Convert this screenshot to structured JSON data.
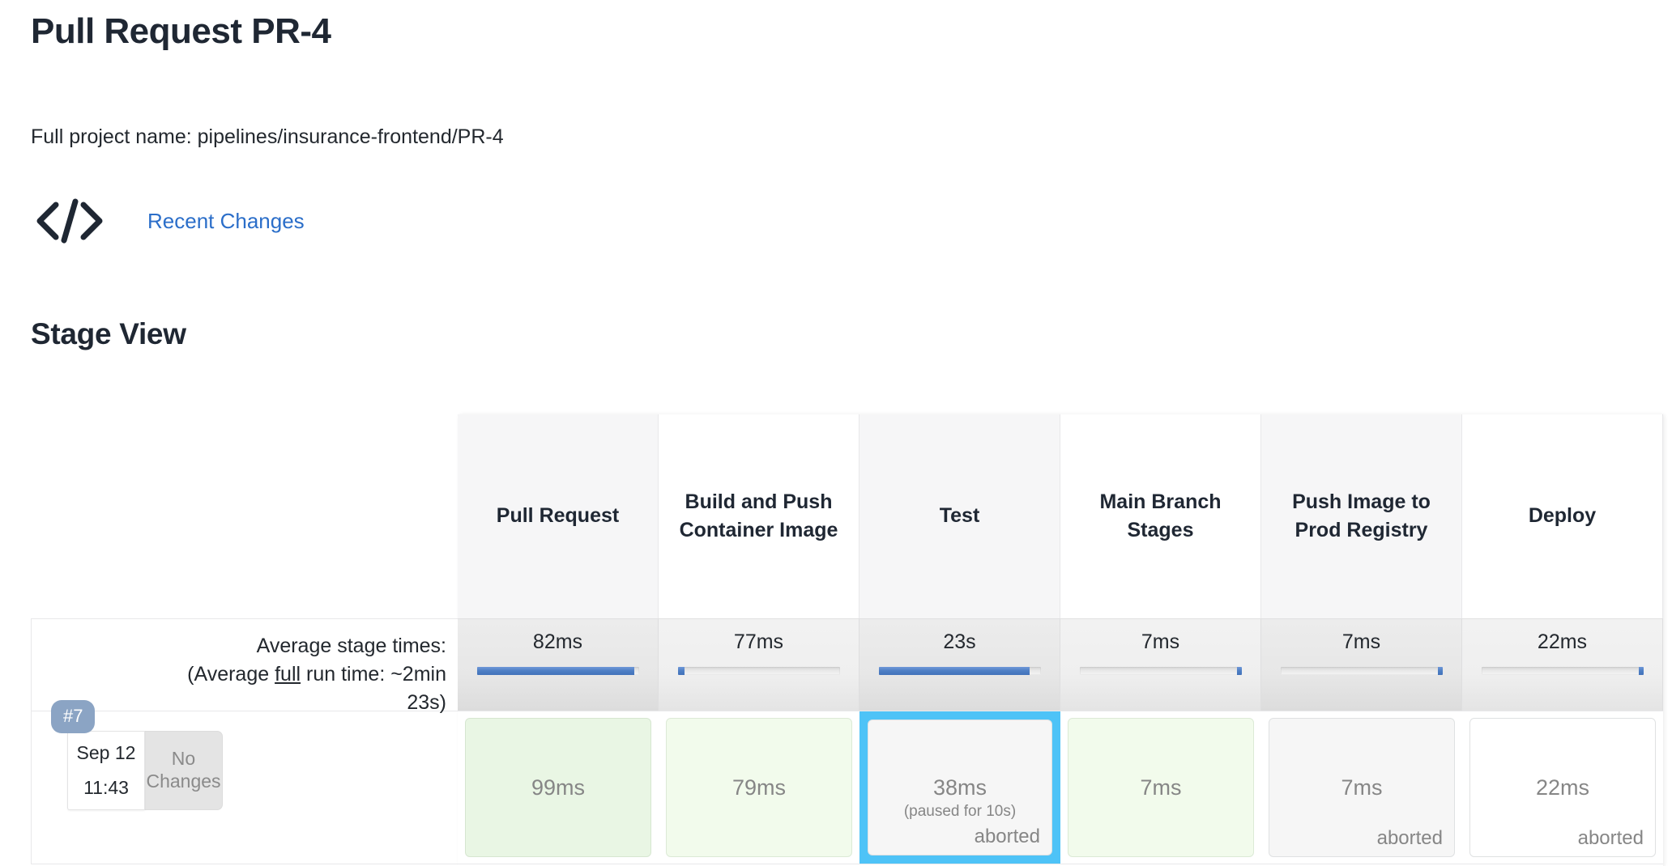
{
  "header": {
    "title": "Pull Request PR-4",
    "project_label": "Full project name: pipelines/insurance-frontend/PR-4",
    "changes_link": "Recent Changes",
    "code_icon": "code-icon",
    "link_color": "#2b6ec9"
  },
  "section": {
    "title": "Stage View"
  },
  "averages": {
    "label_line1": "Average stage times:",
    "label_line2_pre": "(Average ",
    "label_line2_underlined": "full",
    "label_line2_post": " run time: ~2min",
    "label_line3": "23s)"
  },
  "run": {
    "build_number": "#7",
    "date": "Sep 12",
    "time": "11:43",
    "changes": "No Changes"
  },
  "stage_view": {
    "stages": [
      {
        "name": "Pull Request",
        "head_shade": true,
        "avg": "82ms",
        "avg_shade": "dark",
        "bar_pct": 97,
        "bar_side": "left",
        "cell_time": "99ms",
        "cell_style": "green",
        "cell_sub": "",
        "cell_status": "",
        "selected": false
      },
      {
        "name": "Build and Push Container Image",
        "head_shade": false,
        "avg": "77ms",
        "avg_shade": "light",
        "bar_pct": 4,
        "bar_side": "left",
        "cell_time": "79ms",
        "cell_style": "green2",
        "cell_sub": "",
        "cell_status": "",
        "selected": false
      },
      {
        "name": "Test",
        "head_shade": true,
        "avg": "23s",
        "avg_shade": "dark",
        "bar_pct": 93,
        "bar_side": "left",
        "cell_time": "38ms",
        "cell_style": "gray",
        "cell_sub": "(paused for 10s)",
        "cell_status": "aborted",
        "selected": true
      },
      {
        "name": "Main Branch Stages",
        "head_shade": false,
        "avg": "7ms",
        "avg_shade": "light",
        "bar_pct": 3,
        "bar_side": "right",
        "cell_time": "7ms",
        "cell_style": "green2",
        "cell_sub": "",
        "cell_status": "",
        "selected": false
      },
      {
        "name": "Push Image to Prod Registry",
        "head_shade": true,
        "avg": "7ms",
        "avg_shade": "dark",
        "bar_pct": 3,
        "bar_side": "right",
        "cell_time": "7ms",
        "cell_style": "gray",
        "cell_sub": "",
        "cell_status": "aborted",
        "selected": false
      },
      {
        "name": "Deploy",
        "head_shade": false,
        "avg": "22ms",
        "avg_shade": "light",
        "bar_pct": 3,
        "bar_side": "right",
        "cell_time": "22ms",
        "cell_style": "white",
        "cell_sub": "",
        "cell_status": "aborted",
        "selected": false
      }
    ]
  },
  "colors": {
    "accent_blue": "#2b6ec9",
    "selection_blue": "#4ec3f7",
    "bar_blue": "#4d7ec4",
    "badge_blue": "#8ba4c4",
    "success_green": "#e9f6e4",
    "muted_text": "#868686"
  }
}
